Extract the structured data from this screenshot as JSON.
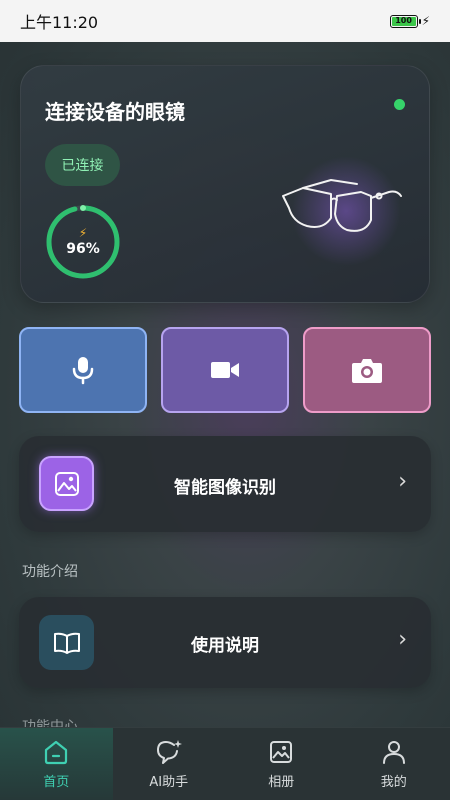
{
  "status_bar": {
    "time": "上午11:20",
    "battery": "100"
  },
  "device": {
    "title": "连接设备的眼镜",
    "connection_status": "已连接",
    "battery_level": "96%",
    "battery_fraction": 0.96
  },
  "quick_actions": [
    {
      "icon": "microphone-icon",
      "color": "#4d74b0"
    },
    {
      "icon": "video-camera-icon",
      "color": "#6d5aa6"
    },
    {
      "icon": "camera-icon",
      "color": "#9c5b82"
    }
  ],
  "features": {
    "recognition_label": "智能图像识别",
    "intro_title": "功能介绍",
    "manual_label": "使用说明",
    "partial_section_title": "功能中心"
  },
  "tabs": [
    {
      "label": "首页",
      "icon": "home-icon",
      "active": true
    },
    {
      "label": "AI助手",
      "icon": "ai-chat-icon",
      "active": false
    },
    {
      "label": "相册",
      "icon": "gallery-icon",
      "active": false
    },
    {
      "label": "我的",
      "icon": "profile-icon",
      "active": false
    }
  ],
  "colors": {
    "accent": "#3fd0b2",
    "online": "#36d36a",
    "gauge": "#2fbf6f"
  }
}
